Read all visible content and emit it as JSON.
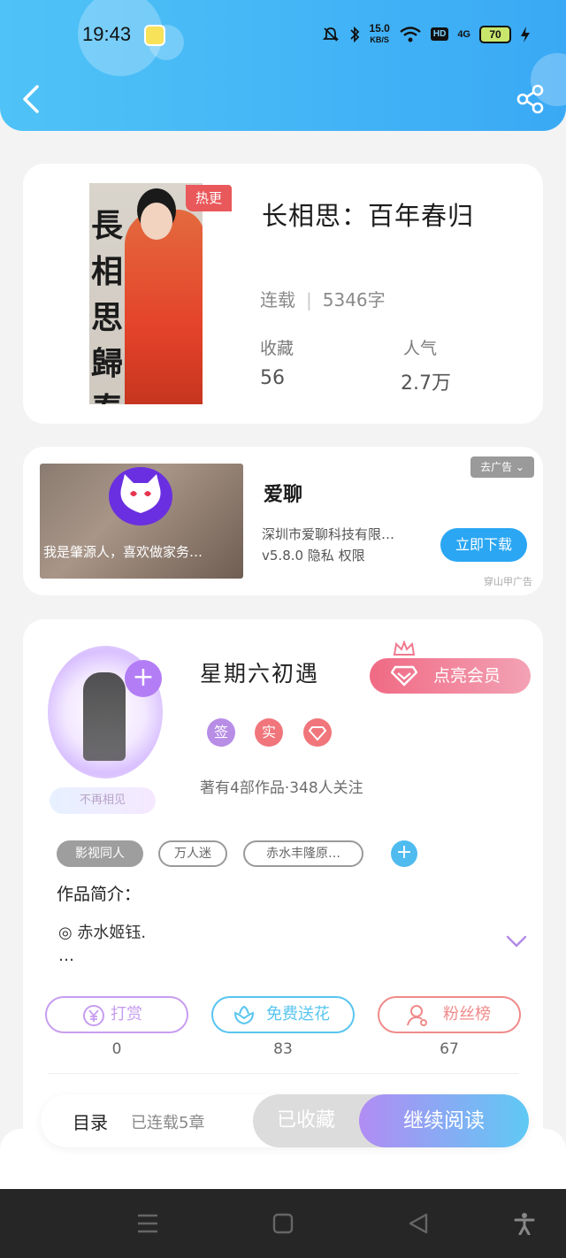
{
  "status_bar": {
    "time": "19:43",
    "net_speed_top": "15.0",
    "net_speed_unit": "KB/S",
    "hd": "HD",
    "network": "4G",
    "battery": "70"
  },
  "header": {
    "back_icon": "chevron-left-icon",
    "share_icon": "share-icon"
  },
  "book": {
    "title": "长相思：百年春归",
    "cover_text": "長相思歸春",
    "badge": "热更",
    "status": "连载",
    "word_count": "5346字",
    "favorites_label": "收藏",
    "favorites_value": "56",
    "popularity_label": "人气",
    "popularity_value": "2.7万"
  },
  "ad": {
    "remove_label": "去广告 ⌄",
    "image_caption": "我是肇源人，喜欢做家务…",
    "title": "爱聊",
    "company": "深圳市爱聊科技有限…",
    "version_line": "v5.8.0 隐私 权限",
    "download_label": "立即下载",
    "source": "穿山甲广告"
  },
  "author": {
    "name": "星期六初遇",
    "tag": "不再相见",
    "vip_label": "点亮会员",
    "badges": [
      {
        "text": "签",
        "color": "#b78de6"
      },
      {
        "text": "实",
        "color": "#f0767b"
      },
      {
        "text": "",
        "color": "#f0767b"
      }
    ],
    "meta": "著有4部作品·348人关注",
    "tags": [
      "影视同人",
      "万人迷",
      "赤水丰隆原…"
    ],
    "intro_label": "作品简介：",
    "intro_text": "◎ 赤水姬钰.",
    "intro_more": "…"
  },
  "actions": [
    {
      "label": "打赏",
      "count": "0",
      "color": "#c79df0"
    },
    {
      "label": "免费送花",
      "count": "83",
      "color": "#58c5ef"
    },
    {
      "label": "粉丝榜",
      "count": "67",
      "color": "#f08a8a"
    }
  ],
  "bottom_bar": {
    "toc_label": "目录",
    "toc_status": "已连载5章",
    "collected_label": "已收藏",
    "read_label": "继续阅读"
  }
}
